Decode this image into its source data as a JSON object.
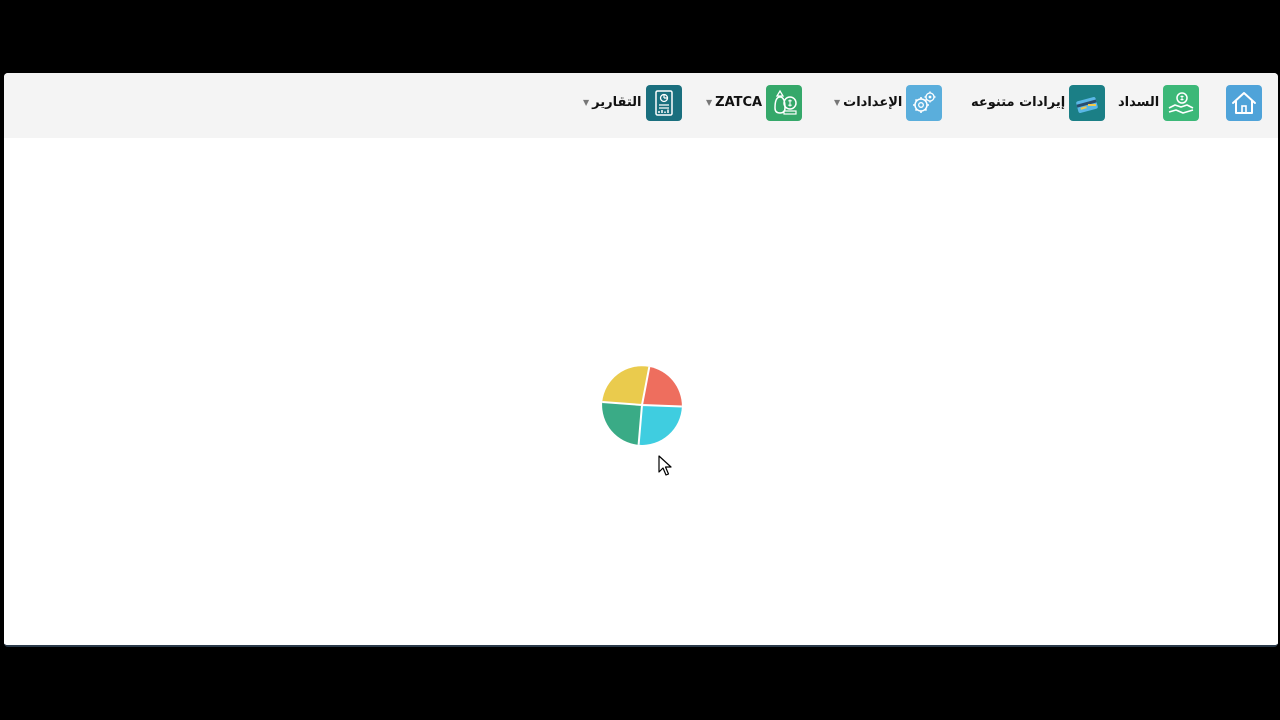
{
  "navbar": {
    "items": [
      {
        "id": "home",
        "label": "",
        "icon": "home-icon",
        "color": "#4fa3d9",
        "has_dropdown": false
      },
      {
        "id": "payment",
        "label": "السداد",
        "icon": "handshake-money-icon",
        "color": "#3cb878",
        "has_dropdown": false
      },
      {
        "id": "misc_revenue",
        "label": "إيرادات متنوعه",
        "icon": "credit-card-icon",
        "color": "#1b7f86",
        "has_dropdown": false
      },
      {
        "id": "settings",
        "label": "الإعدادات",
        "icon": "gears-icon",
        "color": "#5aaedc",
        "has_dropdown": true
      },
      {
        "id": "zatca",
        "label": "ZATCA",
        "icon": "money-bag-icon",
        "color": "#35a86a",
        "has_dropdown": true
      },
      {
        "id": "reports",
        "label": "التقارير",
        "icon": "report-icon",
        "color": "#1a6f7e",
        "has_dropdown": true
      }
    ],
    "caret": "▼"
  },
  "loader": {
    "icon": "pie-loading-icon",
    "colors": {
      "yellow": "#eacb4d",
      "red": "#ee6e5e",
      "cyan": "#3fcde0",
      "green": "#3aab86"
    }
  }
}
